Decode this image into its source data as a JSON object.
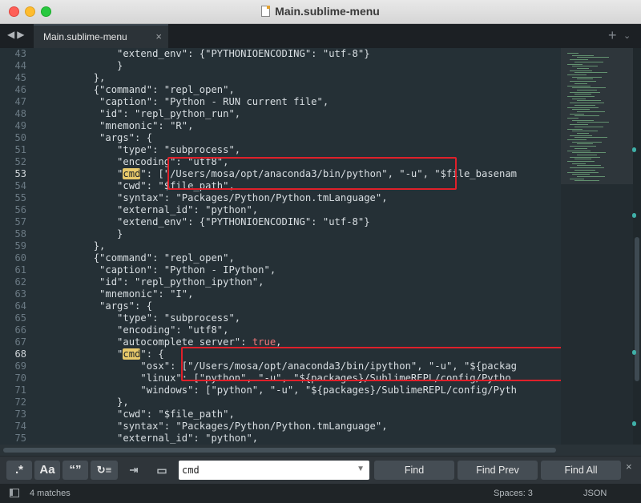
{
  "window": {
    "title": "Main.sublime-menu"
  },
  "tabs": [
    {
      "label": "Main.sublime-menu",
      "close": "×"
    }
  ],
  "tabbar": {
    "nav": "◀▶",
    "plus": "+",
    "chevron": "⌄"
  },
  "gutter": {
    "active_lines": [
      "53",
      "68"
    ],
    "lines": [
      "43",
      "44",
      "45",
      "46",
      "47",
      "48",
      "49",
      "50",
      "51",
      "52",
      "53",
      "54",
      "55",
      "56",
      "57",
      "58",
      "59",
      "60",
      "61",
      "62",
      "63",
      "64",
      "65",
      "66",
      "67",
      "68",
      "69",
      "70",
      "71",
      "72",
      "73",
      "74",
      "75"
    ]
  },
  "code_lines": [
    "            \"extend_env\": {\"PYTHONIOENCODING\": \"utf-8\"}",
    "            }",
    "        },",
    "        {\"command\": \"repl_open\",",
    "         \"caption\": \"Python - RUN current file\",",
    "         \"id\": \"repl_python_run\",",
    "         \"mnemonic\": \"R\",",
    "         \"args\": {",
    "            \"type\": \"subprocess\",",
    "            \"encoding\": \"utf8\",",
    "            \"cmd\": [\"/Users/mosa/opt/anaconda3/bin/python\", \"-u\", \"$file_basenam",
    "            \"cwd\": \"$file_path\",",
    "            \"syntax\": \"Packages/Python/Python.tmLanguage\",",
    "            \"external_id\": \"python\",",
    "            \"extend_env\": {\"PYTHONIOENCODING\": \"utf-8\"}",
    "            }",
    "        },",
    "        {\"command\": \"repl_open\",",
    "         \"caption\": \"Python - IPython\",",
    "         \"id\": \"repl_python_ipython\",",
    "         \"mnemonic\": \"I\",",
    "         \"args\": {",
    "            \"type\": \"subprocess\",",
    "            \"encoding\": \"utf8\",",
    "            \"autocomplete_server\": true,",
    "            \"cmd\": {",
    "                \"osx\": [\"/Users/mosa/opt/anaconda3/bin/ipython\", \"-u\", \"${packag",
    "                \"linux\": [\"python\", \"-u\", \"${packages}/SublimeREPL/config/Pytho",
    "                \"windows\": [\"python\", \"-u\", \"${packages}/SublimeREPL/config/Pyth",
    "            },",
    "            \"cwd\": \"$file_path\",",
    "            \"syntax\": \"Packages/Python/Python.tmLanguage\",",
    "            \"external_id\": \"python\","
  ],
  "find": {
    "regex_label": ".*",
    "case_label": "Aa",
    "word_label": "“”",
    "wrap_label": "↻≡",
    "selection_label": "⇥",
    "highlight_label": "▭",
    "query": "cmd",
    "dropdown": "▼",
    "find_label": "Find",
    "find_prev_label": "Find Prev",
    "find_all_label": "Find All",
    "close": "×"
  },
  "status": {
    "matches": "4 matches",
    "spaces": "Spaces: 3",
    "syntax": "JSON"
  },
  "colors": {
    "editor_bg": "#253036",
    "highlight": "#e8c96a",
    "annotation_box": "#e0202a",
    "keyword_true": "#f2777a"
  }
}
